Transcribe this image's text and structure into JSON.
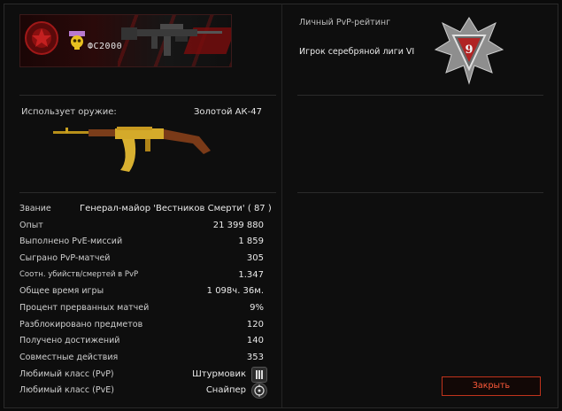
{
  "banner": {
    "nickname": "ФС2000",
    "clan_emblem_icon": "clan-emblem-icon",
    "badge_icon": "skull-icon",
    "weapon_icon": "rifle-icon"
  },
  "weapon": {
    "label": "Использует оружие:",
    "name": "Золотой АК-47",
    "image_icon": "golden-ak47-icon"
  },
  "stats": [
    {
      "key": "Звание",
      "value": "Генерал-майор 'Вестников Смерти' ( 87 )"
    },
    {
      "key": "Опыт",
      "value": "21 399 880"
    },
    {
      "key": "Выполнено PvE-миссий",
      "value": "1 859"
    },
    {
      "key": "Сыграно PvP-матчей",
      "value": "305"
    },
    {
      "key": "Соотн. убийств/смертей в PvP",
      "value": "1.347"
    },
    {
      "key": "Общее время игры",
      "value": "1 098ч. 36м."
    },
    {
      "key": "Процент прерванных матчей",
      "value": "9%"
    },
    {
      "key": "Разблокировано предметов",
      "value": "120"
    },
    {
      "key": "Получено достижений",
      "value": "140"
    },
    {
      "key": "Совместные действия",
      "value": "353"
    },
    {
      "key": "Любимый класс (PvP)",
      "value": "Штурмовик",
      "icon": "assault-class-icon"
    },
    {
      "key": "Любимый класс (PvE)",
      "value": "Снайпер",
      "icon": "sniper-class-icon"
    }
  ],
  "pvp": {
    "title": "Личный PvP-рейтинг",
    "league": "Игрок серебряной лиги VI",
    "badge_number": "9",
    "badge_icon": "silver-league-badge-icon"
  },
  "close_label": "Закрыть",
  "colors": {
    "accent": "#ff5a3a",
    "button_border": "#c0331c",
    "background": "#0b0b0b"
  }
}
